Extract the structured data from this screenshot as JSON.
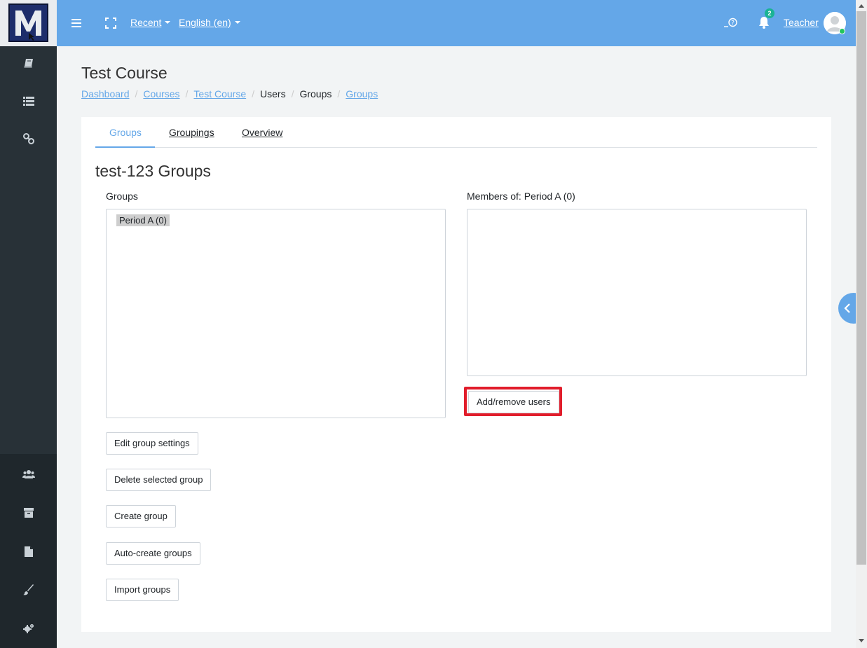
{
  "app": {
    "logo_letter": "M",
    "accent_color": "#64a7e8",
    "highlight_color": "#e11d2b"
  },
  "topbar": {
    "menu_icon": "hamburger-icon",
    "fullscreen_icon": "fullscreen-icon",
    "recent_label": "Recent",
    "language_label": "English (en)",
    "help_label": "_?",
    "notification_count": "2",
    "username": "Teacher"
  },
  "sidebar": {
    "top_icons": [
      "book-icon",
      "list-icon",
      "link-icon"
    ],
    "bottom_icons": [
      "users-icon",
      "archive-icon",
      "file-icon",
      "brush-icon",
      "cogs-icon"
    ]
  },
  "page": {
    "title": "Test Course",
    "breadcrumb": {
      "dashboard": "Dashboard",
      "courses": "Courses",
      "course": "Test Course",
      "users": "Users",
      "groups_plain": "Groups",
      "groups_link": "Groups"
    }
  },
  "tabs": {
    "groups": "Groups",
    "groupings": "Groupings",
    "overview": "Overview"
  },
  "main": {
    "heading": "test-123 Groups",
    "groups_label": "Groups",
    "groups_list": [
      "Period A (0)"
    ],
    "members_label": "Members of: Period A (0)",
    "add_remove_users": "Add/remove users",
    "edit_group_settings": "Edit group settings",
    "delete_selected_group": "Delete selected group",
    "create_group": "Create group",
    "auto_create_groups": "Auto-create groups",
    "import_groups": "Import groups"
  }
}
